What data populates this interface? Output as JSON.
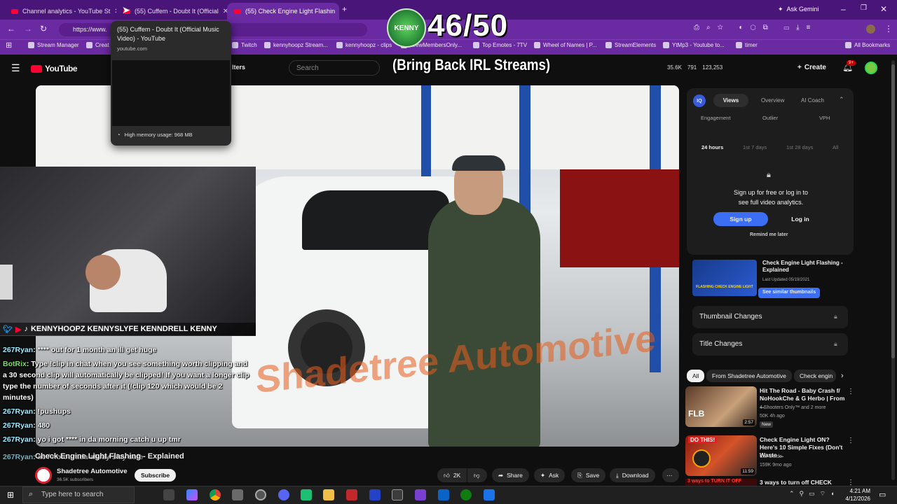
{
  "tabs": [
    {
      "title": "Channel analytics - YouTube St"
    },
    {
      "title": "(55) Cuffem - Doubt It (Official"
    },
    {
      "title": "(55) Check Engine Light Flashin"
    }
  ],
  "ask_gemini": "Ask Gemini",
  "url": "https://www.",
  "bookmarks": [
    "Stream Manager",
    "Creat",
    "Twitch",
    "kennyhoopz Stream...",
    "kennyhoopz - clips",
    "KrewMembersOnly...",
    "Top Emotes - 7TV",
    "Wheel of Names | P...",
    "StreamElements",
    "YtMp3 - Youtube to...",
    "timer",
    "All Bookmarks"
  ],
  "tooltip": {
    "title": "(55) Cuffem - Doubt It (Official Music Video) - YouTube",
    "domain": "youtube.com",
    "memory": "High memory usage: 968 MB"
  },
  "overlay": {
    "counter": "46/50",
    "subtitle": "(Bring Back IRL Streams)",
    "logo_text": "KENNY"
  },
  "youtube": {
    "logo": "YouTube",
    "filters_label": "lters",
    "search_placeholder": "Search",
    "stats": [
      "35.6K",
      "791",
      "123,253"
    ],
    "create": "Create",
    "notif_count": "9+"
  },
  "socials": "KENNYHOOPZ  KENNYSLYFE  KENNDRELL  KENNY",
  "chat": [
    {
      "user": "267Ryan",
      "text": ": **** out for 1 month an ill get huge"
    },
    {
      "user": "BotRix",
      "text": ": Type !clip in chat when you see something worth clipping and a 30 second clip will automatically be clipped! If you want a longer clip type the number of seconds after it (!clip 120 which would be 2 minutes)"
    },
    {
      "user": "267Ryan",
      "text": ": !pushups"
    },
    {
      "user": "267Ryan",
      "text": ": 480"
    },
    {
      "user": "267Ryan",
      "text": ": yo i got **** in da morning catch u up tmr"
    },
    {
      "user": "267Ryan",
      "text": ": ac / notourada alway slay safe"
    }
  ],
  "video": {
    "title": "Check Engine Light Flashing - Explained",
    "channel": "Shadetree Automotive",
    "subs": "36.5K subscribers",
    "subscribe": "Subscribe",
    "likes": "2K",
    "share": "Share",
    "ask": "Ask",
    "save": "Save",
    "download": "Download",
    "overlay_text": "Shadetree Automotive"
  },
  "vidiq": {
    "tabs": [
      "Views",
      "Overview",
      "AI Coach"
    ],
    "metrics": [
      "Engagement",
      "Outlier",
      "VPH"
    ],
    "ranges": [
      "24 hours",
      "1st 7 days",
      "1st 28 days",
      "All"
    ],
    "signup_text": "Sign up for free or log in to see full video analytics.",
    "signup": "Sign up",
    "login": "Log in",
    "remind": "Remind me later",
    "thumb_title": "Check Engine Light Flashing - Explained",
    "thumb_date": "Last Updated 05/19/2021",
    "see_similar": "See similar thumbnails",
    "thumb_label": "FLASHING CHECK ENGINE LIGHT",
    "thumbnail_changes": "Thumbnail Changes",
    "title_changes": "Title Changes"
  },
  "chips": [
    "All",
    "From Shadetree Automotive",
    "Check engin"
  ],
  "recs": [
    {
      "title": "Hit The Road - Baby Crash f/ NoHookChe & G Herbo | From ...",
      "channel": "4 Shooters Only™ and 2 more",
      "meta": "50K  4h ago",
      "badge": "New",
      "duration": "2:57",
      "thumb_text": "FLB"
    },
    {
      "title": "Check Engine Light ON? Here's 10 Simple Fixes (Don't Waste ...",
      "channel": "Car Guide",
      "meta": "159K  9mo ago",
      "duration": "11:59",
      "thumb_text": "DO THIS!"
    },
    {
      "title": "3 ways to turn off CHECK",
      "thumb_text": "3 ways to TURN IT OFF"
    }
  ],
  "taskbar": {
    "search": "Type here to search",
    "time": "4:21 AM",
    "date": "4/12/2026"
  }
}
